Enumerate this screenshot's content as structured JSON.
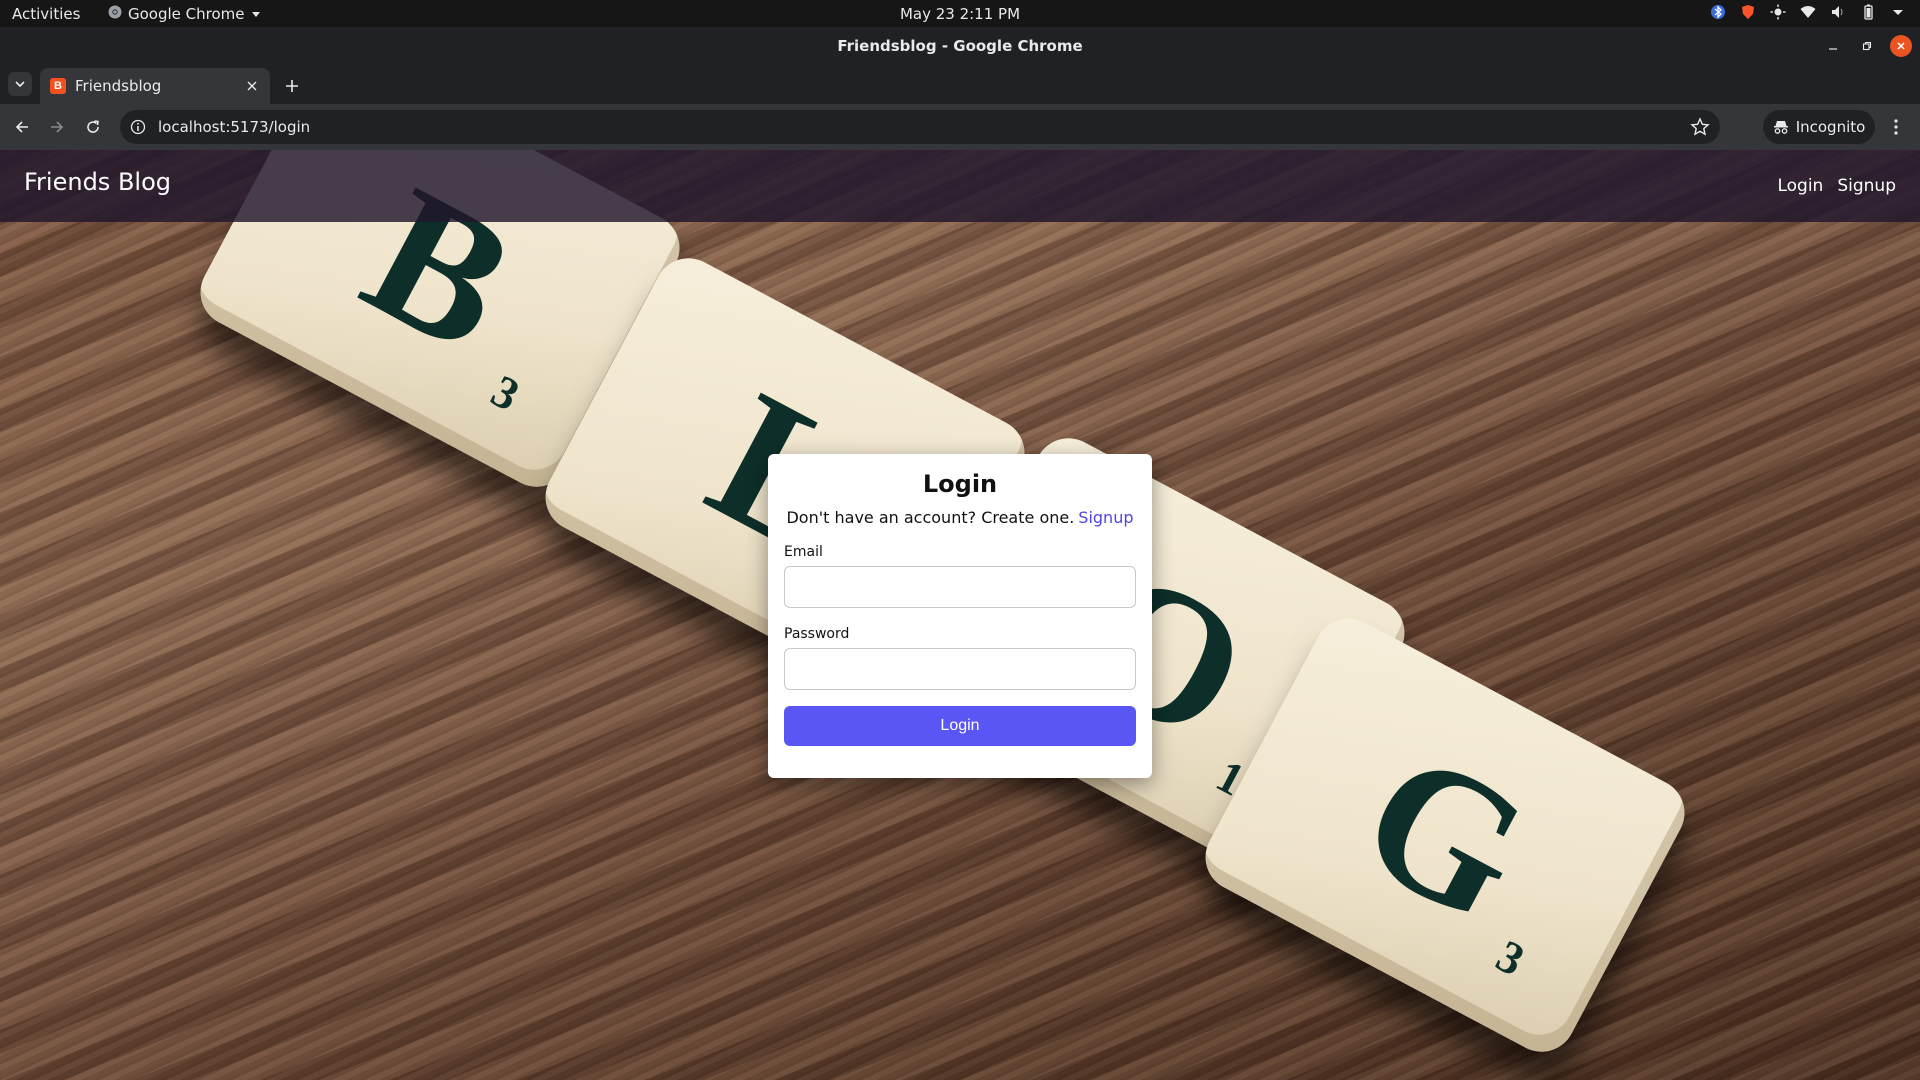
{
  "system": {
    "activities": "Activities",
    "app_name": "Google Chrome",
    "clock": "May 23  2:11 PM"
  },
  "window": {
    "title": "Friendsblog - Google Chrome"
  },
  "tab": {
    "title": "Friendsblog",
    "favicon_letter": "B"
  },
  "omnibox": {
    "url": "localhost:5173/login"
  },
  "profile": {
    "label": "Incognito"
  },
  "site": {
    "brand": "Friends Blog",
    "nav": {
      "login": "Login",
      "signup": "Signup"
    }
  },
  "background_tiles": [
    {
      "letter": "B",
      "score": "3"
    },
    {
      "letter": "L",
      "score": ""
    },
    {
      "letter": "O",
      "score": "1"
    },
    {
      "letter": "G",
      "score": "3"
    }
  ],
  "login_form": {
    "heading": "Login",
    "prompt": "Don't have an account? Create one.",
    "signup_link": "Signup",
    "email_label": "Email",
    "email_value": "",
    "password_label": "Password",
    "password_value": "",
    "submit_label": "Login"
  },
  "colors": {
    "primary_button": "#5a55f5",
    "link": "#4f46e5",
    "navbar": "#20162c",
    "close_button": "#e95420"
  }
}
